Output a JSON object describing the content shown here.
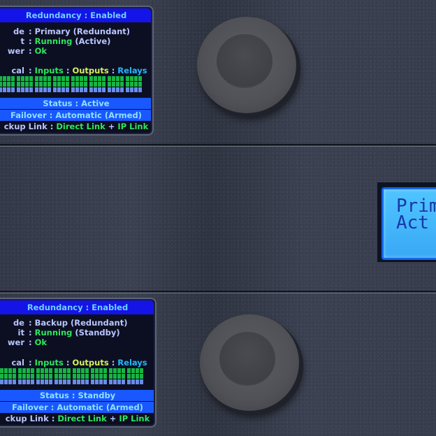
{
  "units": [
    {
      "header": "Redundancy : Enabled",
      "rows": [
        {
          "label": "de",
          "value": "Primary (Redundant)",
          "value_parts": null
        },
        {
          "label": "t",
          "value_a": "Running",
          "value_b": "(Active)"
        },
        {
          "label": "wer",
          "value": "Ok"
        }
      ],
      "levels": {
        "label": "cal",
        "inputs": "Inputs",
        "outputs": "Outputs",
        "relays": "Relays"
      },
      "status": "Status : Active",
      "failover": "Failover : Automatic (Armed)",
      "backup_link": {
        "label": "ckup Link :",
        "direct": "Direct Link",
        "plus": "+",
        "ip": "IP Link"
      }
    },
    {
      "header": "Redundancy : Enabled",
      "rows": [
        {
          "label": "de",
          "value": "Backup (Redundant)"
        },
        {
          "label": "it",
          "value_a": "Running",
          "value_b": "(Standby)"
        },
        {
          "label": "wer",
          "value": "Ok"
        }
      ],
      "levels": {
        "label": "cal",
        "inputs": "Inputs",
        "outputs": "Outputs",
        "relays": "Relays"
      },
      "status": "Status : Standby",
      "failover": "Failover : Automatic (Armed)",
      "backup_link": {
        "label": "ckup Link :",
        "direct": "Direct Link",
        "plus": "+",
        "ip": "IP Link"
      }
    }
  ],
  "lcd": {
    "line1": "Prim",
    "line2": "Act"
  },
  "meter_groups": 8,
  "colors": {
    "header": "#1414e8",
    "status_bar": "#1a58ff",
    "green": "#2ee65c",
    "yellow": "#d6f060",
    "cyan": "#25b8ff",
    "lcd": "#4fc5ff"
  }
}
